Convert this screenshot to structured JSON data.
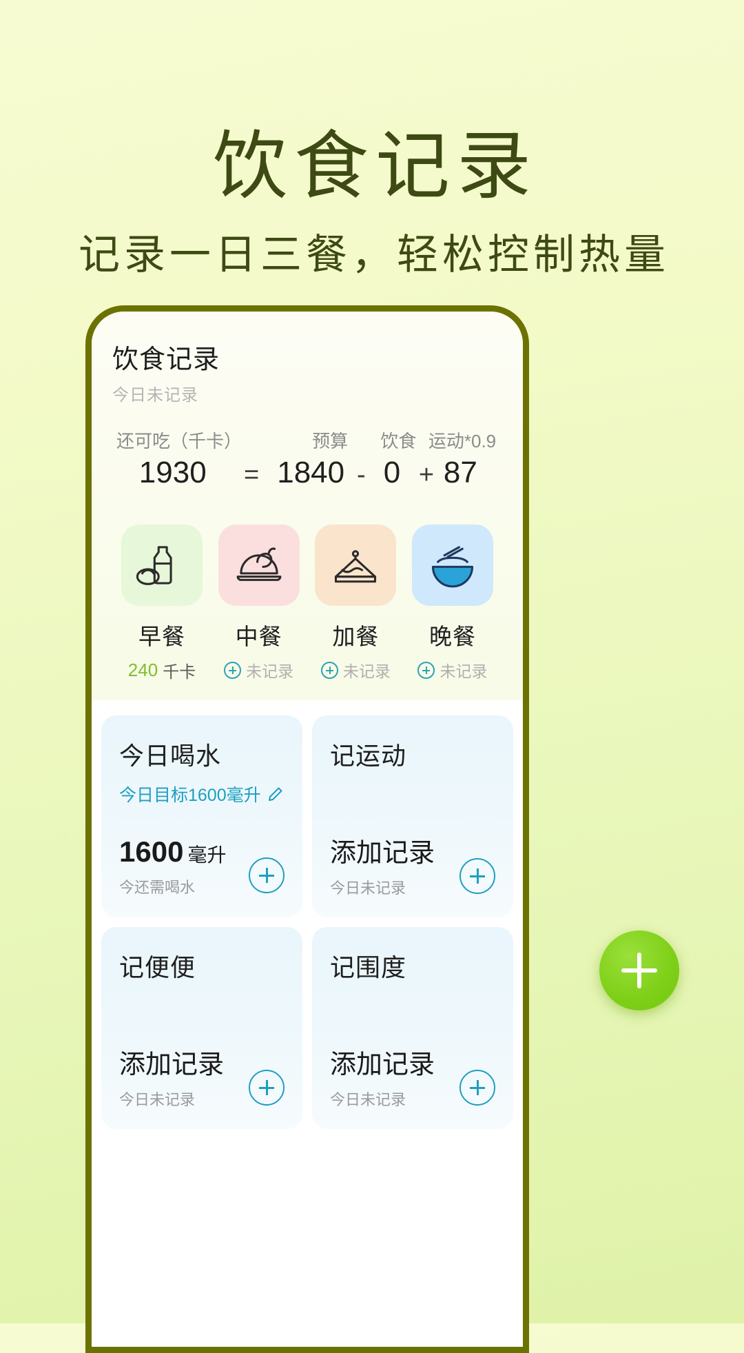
{
  "promo": {
    "title": "饮食记录",
    "subtitle": "记录一日三餐，轻松控制热量",
    "title_color": "#3e4a14",
    "bg_color": "#f3fac8"
  },
  "app": {
    "header": {
      "title": "饮食记录",
      "subtitle": "今日未记录"
    },
    "calorie_summary": {
      "labels": {
        "remaining": "还可吃（千卡）",
        "budget": "预算",
        "diet": "饮食",
        "exercise": "运动*0.9"
      },
      "values": {
        "remaining": "1930",
        "budget": "1840",
        "diet": "0",
        "exercise": "87"
      },
      "operators": {
        "equals": "=",
        "minus": "-",
        "plus": "+"
      }
    },
    "meals": [
      {
        "name": "早餐",
        "icon": "milk-bun-icon",
        "status": "240",
        "unit": "千卡",
        "recorded": true,
        "tile_color": "#e7f7d9"
      },
      {
        "name": "中餐",
        "icon": "roast-chicken-icon",
        "status": "未记录",
        "unit": "",
        "recorded": false,
        "tile_color": "#fbdfdf"
      },
      {
        "name": "加餐",
        "icon": "cake-slice-icon",
        "status": "未记录",
        "unit": "",
        "recorded": false,
        "tile_color": "#fae4cc"
      },
      {
        "name": "晚餐",
        "icon": "noodle-bowl-icon",
        "status": "未记录",
        "unit": "",
        "recorded": false,
        "tile_color": "#cfe8fb"
      }
    ],
    "trackers": [
      {
        "title": "今日喝水",
        "goal": "今日目标1600毫升",
        "main": "1600",
        "unit": "毫升",
        "note": "今还需喝水",
        "has_edit": true
      },
      {
        "title": "记运动",
        "goal": "",
        "main": "添加记录",
        "unit": "",
        "note": "今日未记录",
        "has_edit": false
      },
      {
        "title": "记便便",
        "goal": "",
        "main": "添加记录",
        "unit": "",
        "note": "今日未记录",
        "has_edit": false
      },
      {
        "title": "记围度",
        "goal": "",
        "main": "添加记录",
        "unit": "",
        "note": "今日未记录",
        "has_edit": false
      }
    ],
    "fab": {
      "label": "+",
      "color": "#7ecf18"
    },
    "accent_color": "#1d9fc0",
    "kcal_color": "#7fbe2e"
  }
}
